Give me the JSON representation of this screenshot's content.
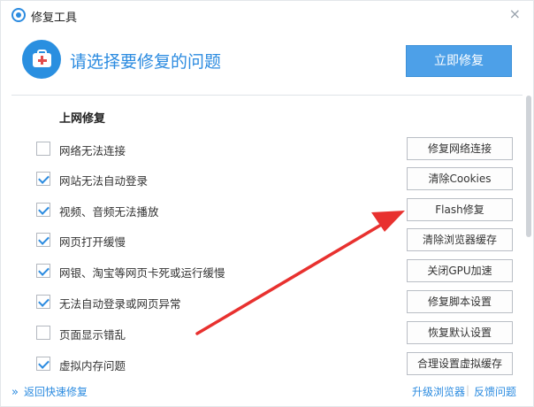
{
  "window": {
    "title": "修复工具",
    "close_glyph": "×"
  },
  "header": {
    "title": "请选择要修复的问题",
    "repair_now_label": "立即修复",
    "icon": "first-aid-kit-icon"
  },
  "section": {
    "title": "上网修复"
  },
  "items": [
    {
      "label": "网络无法连接",
      "checked": false,
      "action": "修复网络连接"
    },
    {
      "label": "网站无法自动登录",
      "checked": true,
      "action": "清除Cookies"
    },
    {
      "label": "视频、音频无法播放",
      "checked": true,
      "action": "Flash修复"
    },
    {
      "label": "网页打开缓慢",
      "checked": true,
      "action": "清除浏览器缓存"
    },
    {
      "label": "网银、淘宝等网页卡死或运行缓慢",
      "checked": true,
      "action": "关闭GPU加速"
    },
    {
      "label": "无法自动登录或网页异常",
      "checked": true,
      "action": "修复脚本设置"
    },
    {
      "label": "页面显示错乱",
      "checked": false,
      "action": "恢复默认设置"
    },
    {
      "label": "虚拟内存问题",
      "checked": true,
      "action": "合理设置虚拟缓存"
    }
  ],
  "footer": {
    "back_label": "返回快速修复",
    "back_chevron": "»",
    "upgrade_label": "升级浏览器",
    "separator": "|",
    "feedback_label": "反馈问题"
  },
  "colors": {
    "accent": "#2b8be0",
    "primary_button": "#4da0e8",
    "annotation_arrow": "#e8312f"
  }
}
